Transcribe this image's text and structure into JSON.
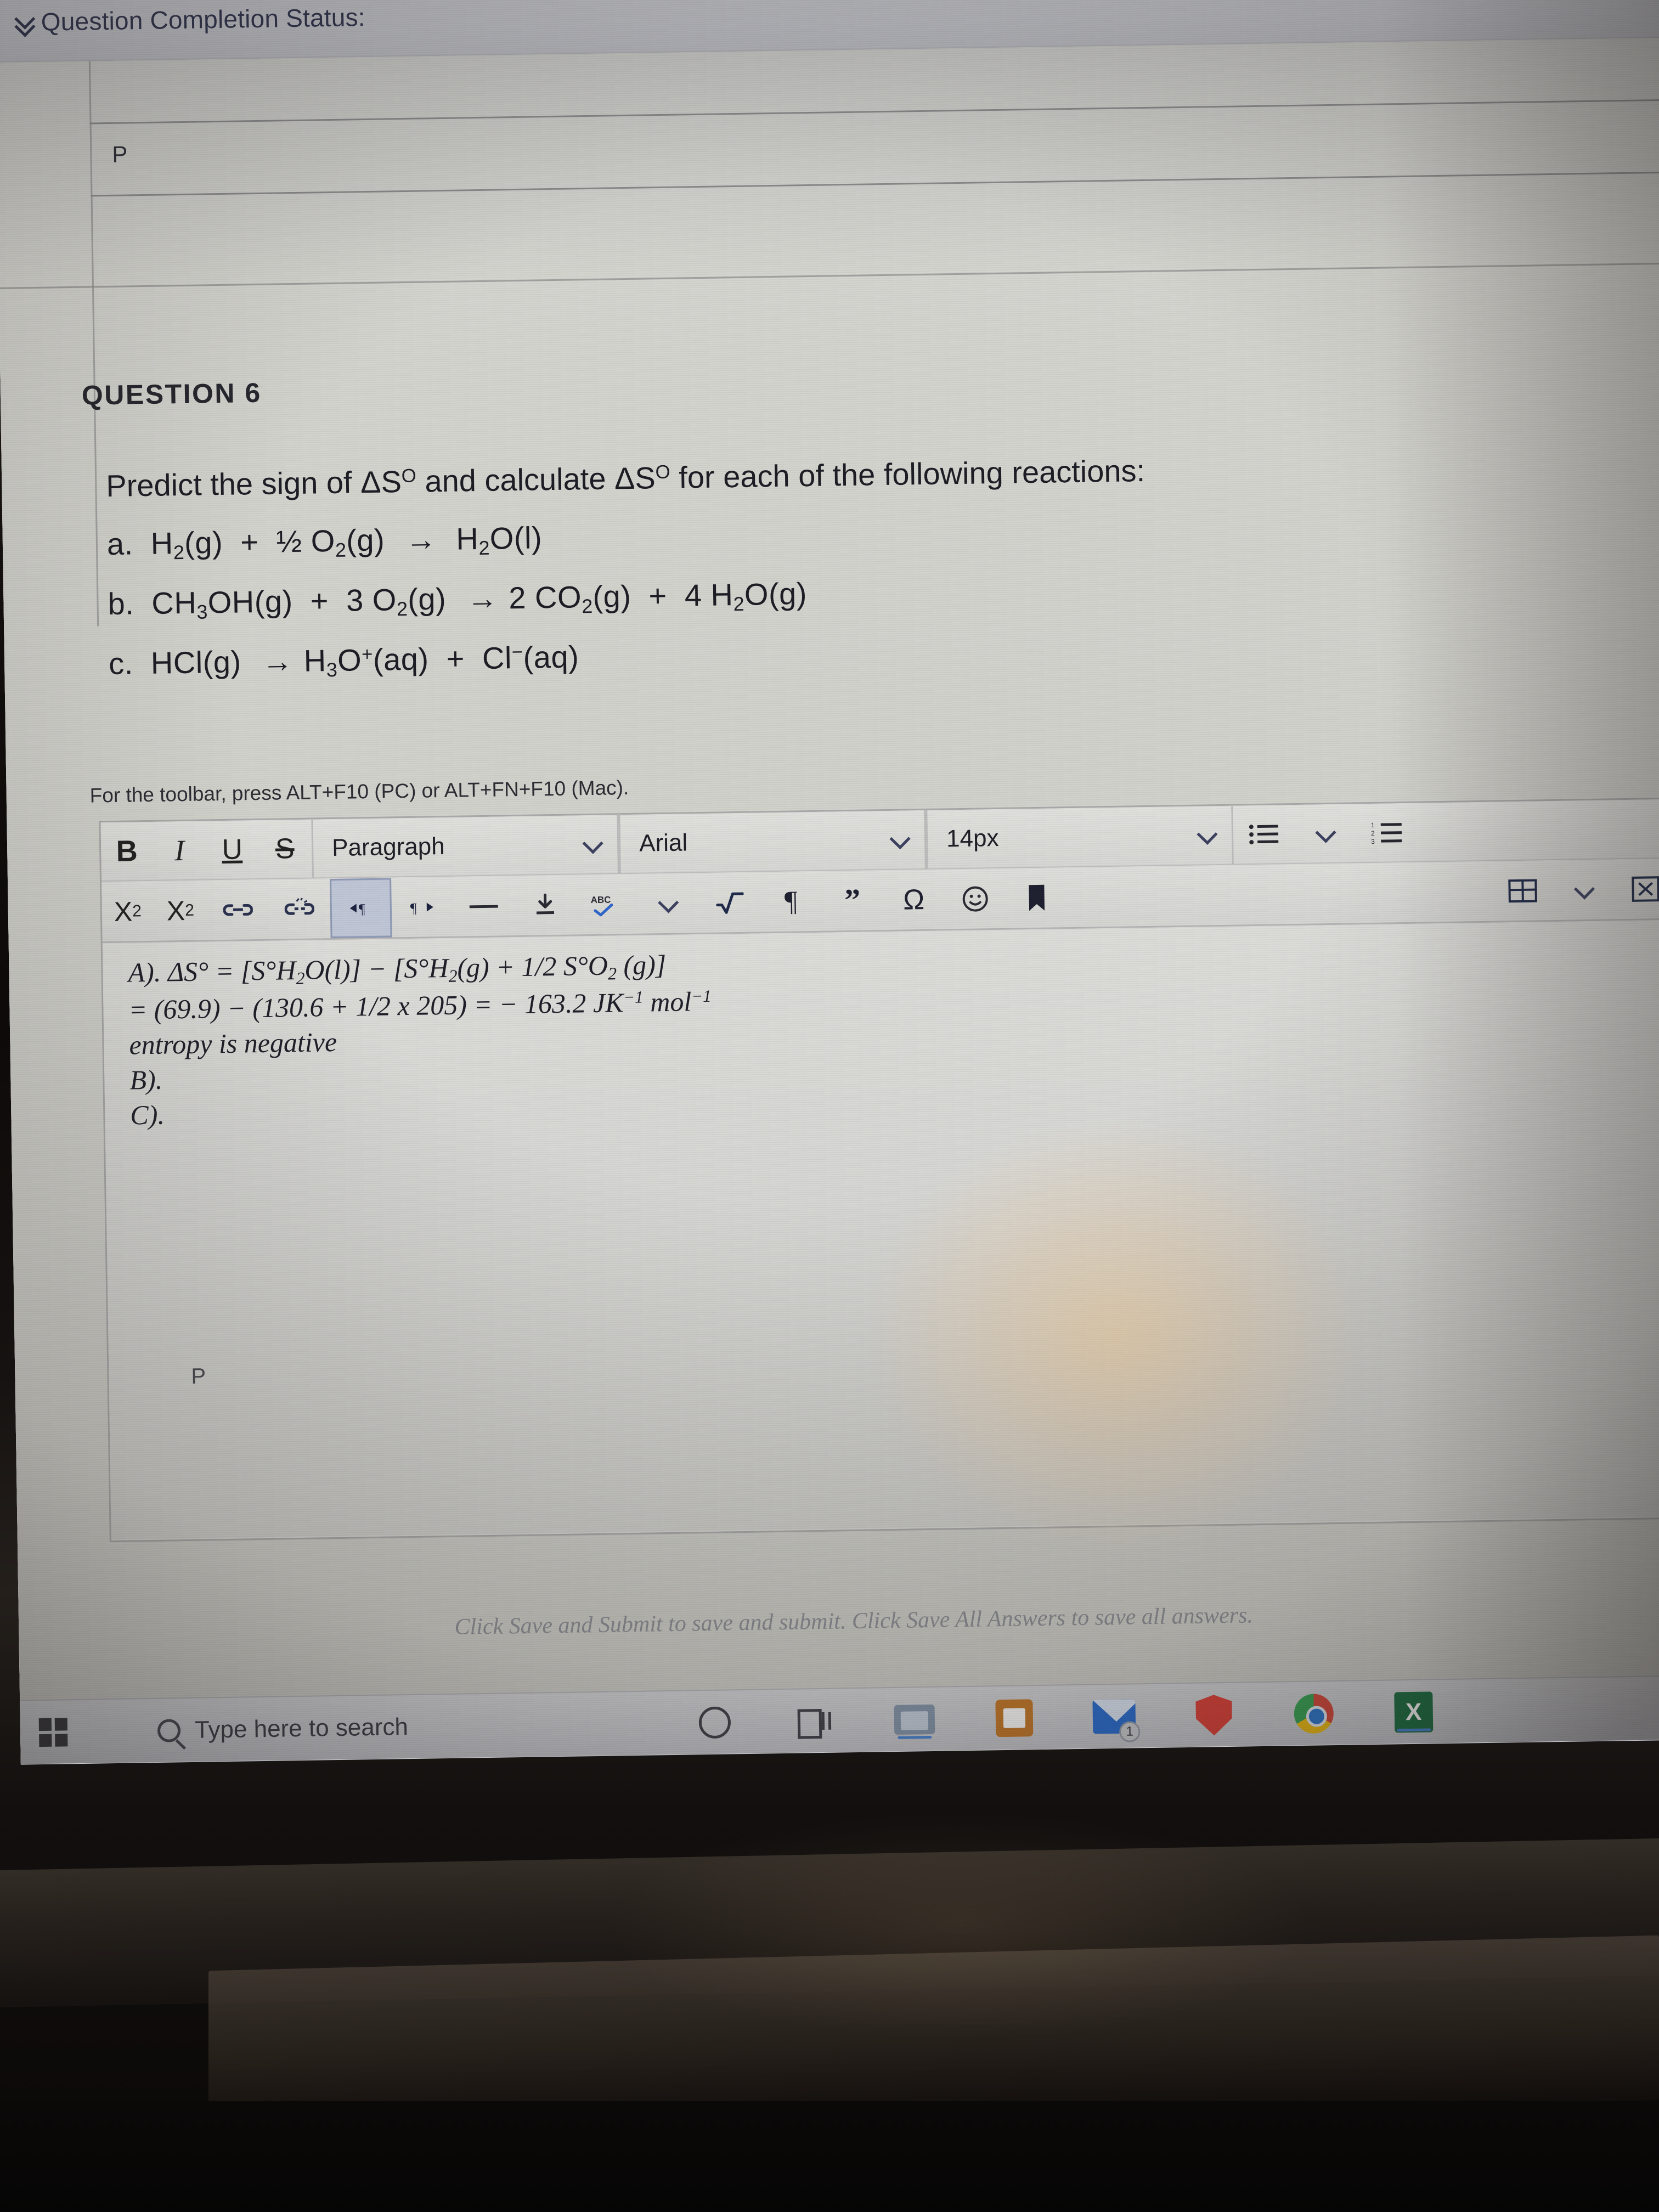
{
  "browser": {
    "status_bar_label": "Question Completion Status:",
    "status_box_letter": "P"
  },
  "question": {
    "title": "QUESTION 6",
    "prompt": "Predict the sign of ΔS° and calculate ΔS° for each of the following reactions:",
    "reactions": [
      {
        "label": "a.",
        "text": "H2(g)  +  ½ O2(g)  →  H2O(l)"
      },
      {
        "label": "b.",
        "text": "CH3OH(g)  +  3 O2(g)  → 2 CO2(g)  +  4 H2O(g)"
      },
      {
        "label": "c.",
        "text": "HCl(g)  → H3O+(aq)  +  Cl⁻(aq)"
      }
    ],
    "toolbar_hint": "For the toolbar, press ALT+F10 (PC) or ALT+FN+F10 (Mac)."
  },
  "editor": {
    "row1": {
      "bold": "B",
      "italic": "I",
      "underline": "U",
      "strikethrough": "S",
      "paragraph_select": "Paragraph",
      "font_select": "Arial",
      "size_select": "14px",
      "bullet_list_icon": "bulleted-list-icon",
      "number_list_icon": "numbered-list-icon"
    },
    "row2": {
      "superscript": "X2",
      "subscript": "X2",
      "link_icon": "link-icon",
      "unlink_icon": "unlink-icon",
      "ltr_icon": "ltr-direction-icon",
      "rtl_icon": "rtl-direction-icon",
      "horizontal_rule_icon": "horizontal-rule-icon",
      "insert_file_icon": "insert-file-icon",
      "spellcheck_icon": "spellcheck-icon",
      "math_icon": "square-root-icon",
      "pilcrow_icon": "paragraph-mark-icon",
      "quote_icon": "blockquote-icon",
      "omega_icon": "special-character-icon",
      "emoji_icon": "emoji-icon",
      "bookmark_icon": "bookmark-icon",
      "table_icon": "table-icon",
      "close_icon": "close-icon",
      "spellcheck_label": "ABC"
    },
    "content": [
      "A). ΔS° = [S°H2O(l)] − [S°H2(g) + 1/2 S°O2 (g)]",
      "= (69.9) − (130.6 + 1/2 x 205) = − 163.2 JK⁻¹ mol⁻¹",
      "entropy is negative",
      "B).",
      "C)."
    ],
    "status_letter": "P"
  },
  "footer": {
    "save_note": "Click Save and Submit to save and submit. Click Save All Answers to save all answers."
  },
  "taskbar": {
    "search_placeholder": "Type here to search",
    "start_icon": "windows-start-icon",
    "search_icon": "search-icon",
    "cortana_icon": "cortana-circle-icon",
    "task_view_icon": "task-view-icon",
    "file_explorer_icon": "file-explorer-icon",
    "store_icon": "microsoft-store-icon",
    "mail_icon": "mail-icon",
    "mail_badge": "1",
    "security_icon": "security-shield-icon",
    "chrome_icon": "chrome-icon",
    "excel_icon": "excel-icon",
    "excel_letter": "X"
  },
  "colors": {
    "screen_bg": "#d3d3ce",
    "header_text": "#2b2f4a",
    "body_text": "#1d1d25",
    "toolbar_bg": "#dededb",
    "selected_tool": "#bfc6d6",
    "footer_text": "#8d8f96",
    "chrome_green": "#3aa757",
    "shield_red": "#e0433a",
    "excel_green": "#1e7145",
    "mail_blue": "#2b6fd4"
  }
}
